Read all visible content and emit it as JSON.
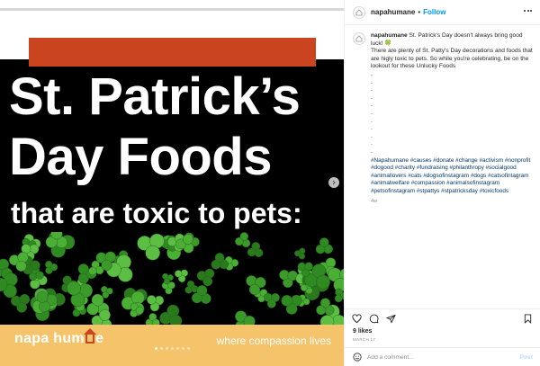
{
  "post": {
    "image": {
      "headline_line1": "St. Patrick’s",
      "headline_line2": "Day Foods",
      "headline_line3": "that are toxic to pets:",
      "brand_name_part1": "napa hum",
      "brand_name_part2": "e",
      "brand_tagline": "where compassion lives",
      "carousel_dots": 7,
      "active_dot": 0,
      "colors": {
        "top_bar": "#c9441f",
        "footer_band": "#f5c36a",
        "clover_green": "#3c9a2a"
      }
    }
  },
  "panel": {
    "username": "napahumane",
    "separator": "•",
    "follow_label": "Follow",
    "caption": {
      "username": "napahumane",
      "line1": "St. Patrick's Day doesn't always bring good",
      "line2": "luck! 🍀",
      "line3": "There are plenty of St. Patty's Day decorations and foods that",
      "line4": "are higly toxic to pets. So while you're celebrating, be on the",
      "line5": "lookout for these Unlucky Foods",
      "spacer_dots": [
        ".",
        ".",
        ".",
        ".",
        ".",
        ".",
        ".",
        ".",
        ".",
        ".",
        "."
      ],
      "hashtags": "#Napahumane #causes #donate #change #activism #nonprofit #dogood #charity #fundraising #philanthropy #socialgood #animallovers #cats #dogsofinstagram #dogs #catsofintagram #animalwelfare #compassion #animalsofinstagram #petsofinstagram #stpattys #stpatricksday #toxicfoods",
      "time_ago": "4w"
    },
    "likes": "9 likes",
    "date": "MARCH 17",
    "comment_placeholder": "Add a comment...",
    "post_label": "Post",
    "icons": [
      "heart-icon",
      "comment-icon",
      "share-icon",
      "bookmark-icon",
      "emoji-icon",
      "more-icon",
      "chevron-right-icon"
    ]
  }
}
